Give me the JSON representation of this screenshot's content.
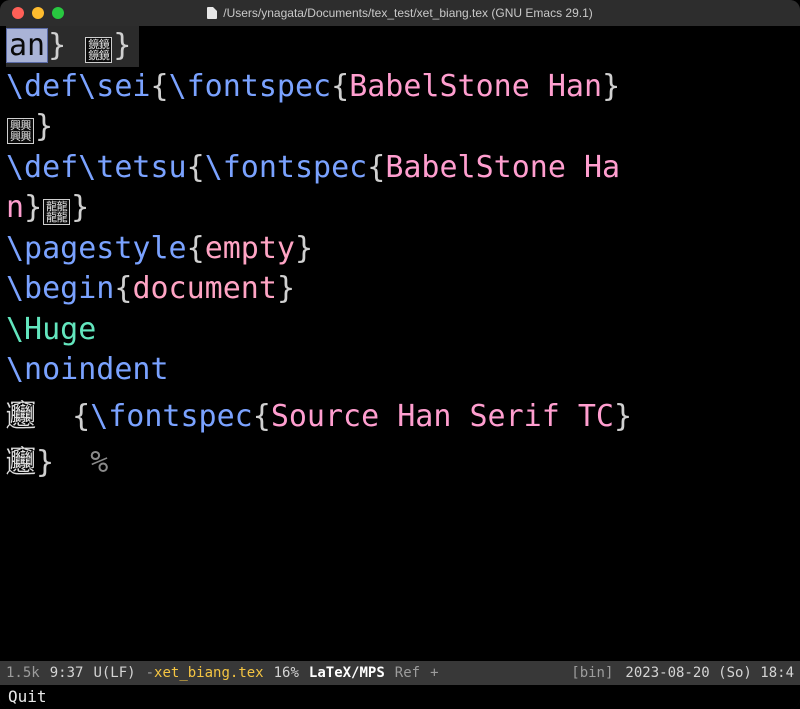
{
  "title": "/Users/ynagata/Documents/tex_test/xet_biang.tex (GNU Emacs 29.1)",
  "traffic": {
    "red": "close",
    "yellow": "minimize",
    "green": "zoom"
  },
  "glyphs": {
    "box1_r1": "鏡鏡",
    "box1_r2": "鏡鏡",
    "box2_r1": "興興",
    "box2_r2": "興興",
    "box3_r1": "龍龍",
    "box3_r2": "龍龍",
    "biang1": "𰻞",
    "biang2": "𰻞"
  },
  "frag": {
    "an": "an",
    "n": "n",
    "rb": "}",
    "lb": "{",
    "percent": "%"
  },
  "code": {
    "def": "\\def",
    "sei": "\\sei",
    "tetsu": "\\tetsu",
    "fontspec": "\\fontspec",
    "pagestyle": "\\pagestyle",
    "begin": "\\begin",
    "huge": "\\Huge",
    "noindent": "\\noindent",
    "babel": "BabelStone Han",
    "babel_ha": "BabelStone Ha",
    "shserif": "Source Han Serif TC",
    "empty": "empty",
    "document": "document"
  },
  "modeline": {
    "size": "1.5k",
    "time": "9:37",
    "enc": "U(LF)",
    "dash": "-",
    "buffer": "xet_biang.tex",
    "pct": "16%",
    "mode": "LaTeX/MPS",
    "ref": "Ref",
    "plus": "+",
    "bin": "[bin]",
    "date": "2023-08-20 (So) 18:4"
  },
  "minibuffer": "Quit"
}
